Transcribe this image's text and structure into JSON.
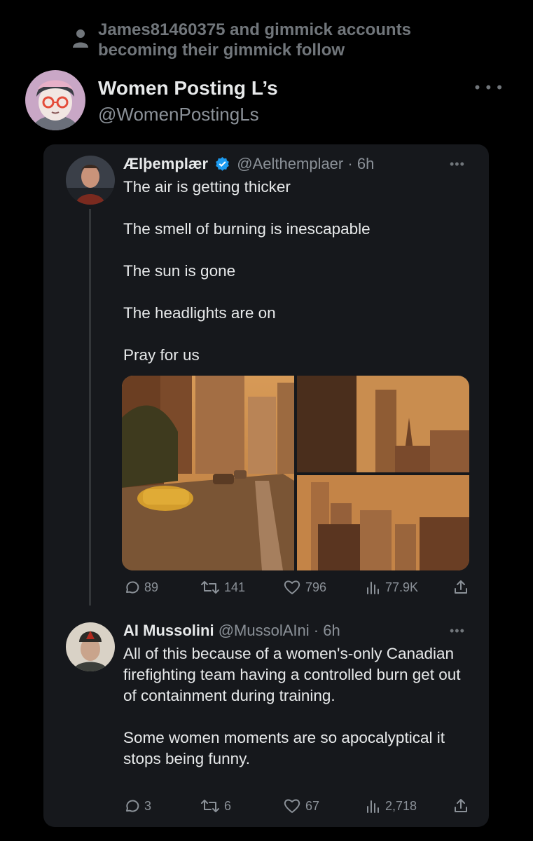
{
  "social_context": {
    "icon": "person-icon",
    "text_line1": "James81460375 and gimmick accounts",
    "text_line2": "becoming their gimmick follow"
  },
  "account": {
    "name": "Women Posting L’s",
    "handle": "@WomenPostingLs",
    "more_icon": "more-horizontal-icon"
  },
  "tweets": [
    {
      "name": "Ælþemplær",
      "verified": true,
      "handle": "@Aelthemplaer",
      "sep": "·",
      "time": "6h",
      "paragraphs": [
        "The air is getting thicker",
        "The smell of burning is inescapable",
        "The sun is gone",
        "The headlights are on",
        "Pray for us"
      ],
      "media": [
        "city-street-smoke-photo",
        "skyline-smoke-photo-1",
        "skyline-smoke-photo-2"
      ],
      "replies": "89",
      "retweets": "141",
      "likes": "796",
      "views": "77.9K"
    },
    {
      "name": "AI Mussolini",
      "verified": false,
      "handle": "@MussolAIni",
      "sep": "·",
      "time": "6h",
      "paragraphs": [
        "All of this because of a women's-only Canadian firefighting team having a controlled burn get out of containment during training.",
        "Some women moments are so apocalyptical it stops being funny."
      ],
      "replies": "3",
      "retweets": "6",
      "likes": "67",
      "views": "2,718"
    }
  ],
  "colors": {
    "background": "#000000",
    "card": "#16181c",
    "text": "#e7e9ea",
    "secondary": "#8b9198",
    "verified": "#1d9bf0",
    "smoke": "#c9874a"
  }
}
